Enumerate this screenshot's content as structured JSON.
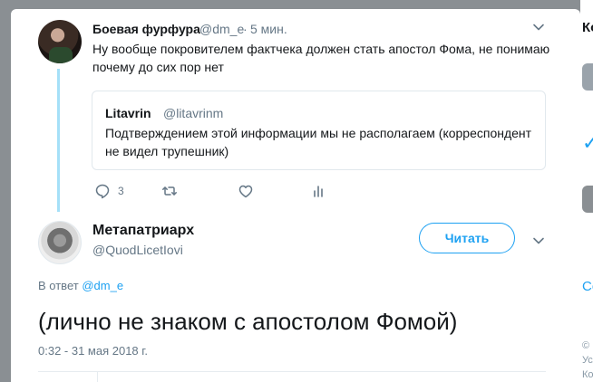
{
  "side": {
    "frag1": "Ко",
    "frag2": "",
    "frag3": "",
    "frag4": "",
    "frag5": "Со",
    "frag6": "© ",
    "frag7": "Усло",
    "frag8": "Кон"
  },
  "parent_tweet": {
    "name": "Боевая фурфура",
    "handle": "@dm_e",
    "dot": "·",
    "time": "5 мин.",
    "text": "Ну вообще покровителем фактчека должен стать апостол Фома, не понимаю почему до сих пор нет",
    "quote": {
      "name": "Litavrin",
      "handle": "@litavrinm",
      "text": "Подтверждением этой информации мы не располагаем (корреспондент не видел трупешник)"
    },
    "actions": {
      "reply_count": "3",
      "retweet_count": "",
      "like_count": ""
    }
  },
  "main_tweet": {
    "name": "Метапатриарх",
    "handle": "@QuodLicetIovi",
    "follow_label": "Читать",
    "reply_prefix": "В ответ",
    "reply_handle": "@dm_e",
    "text": "(лично не знаком с апостолом Фомой)",
    "datetime": "0:32 - 31 мая 2018 г."
  },
  "colors": {
    "accent": "#1da1f2",
    "thread_line": "#a5e0f8",
    "muted": "#657786",
    "backdrop": "#8a8f93"
  }
}
